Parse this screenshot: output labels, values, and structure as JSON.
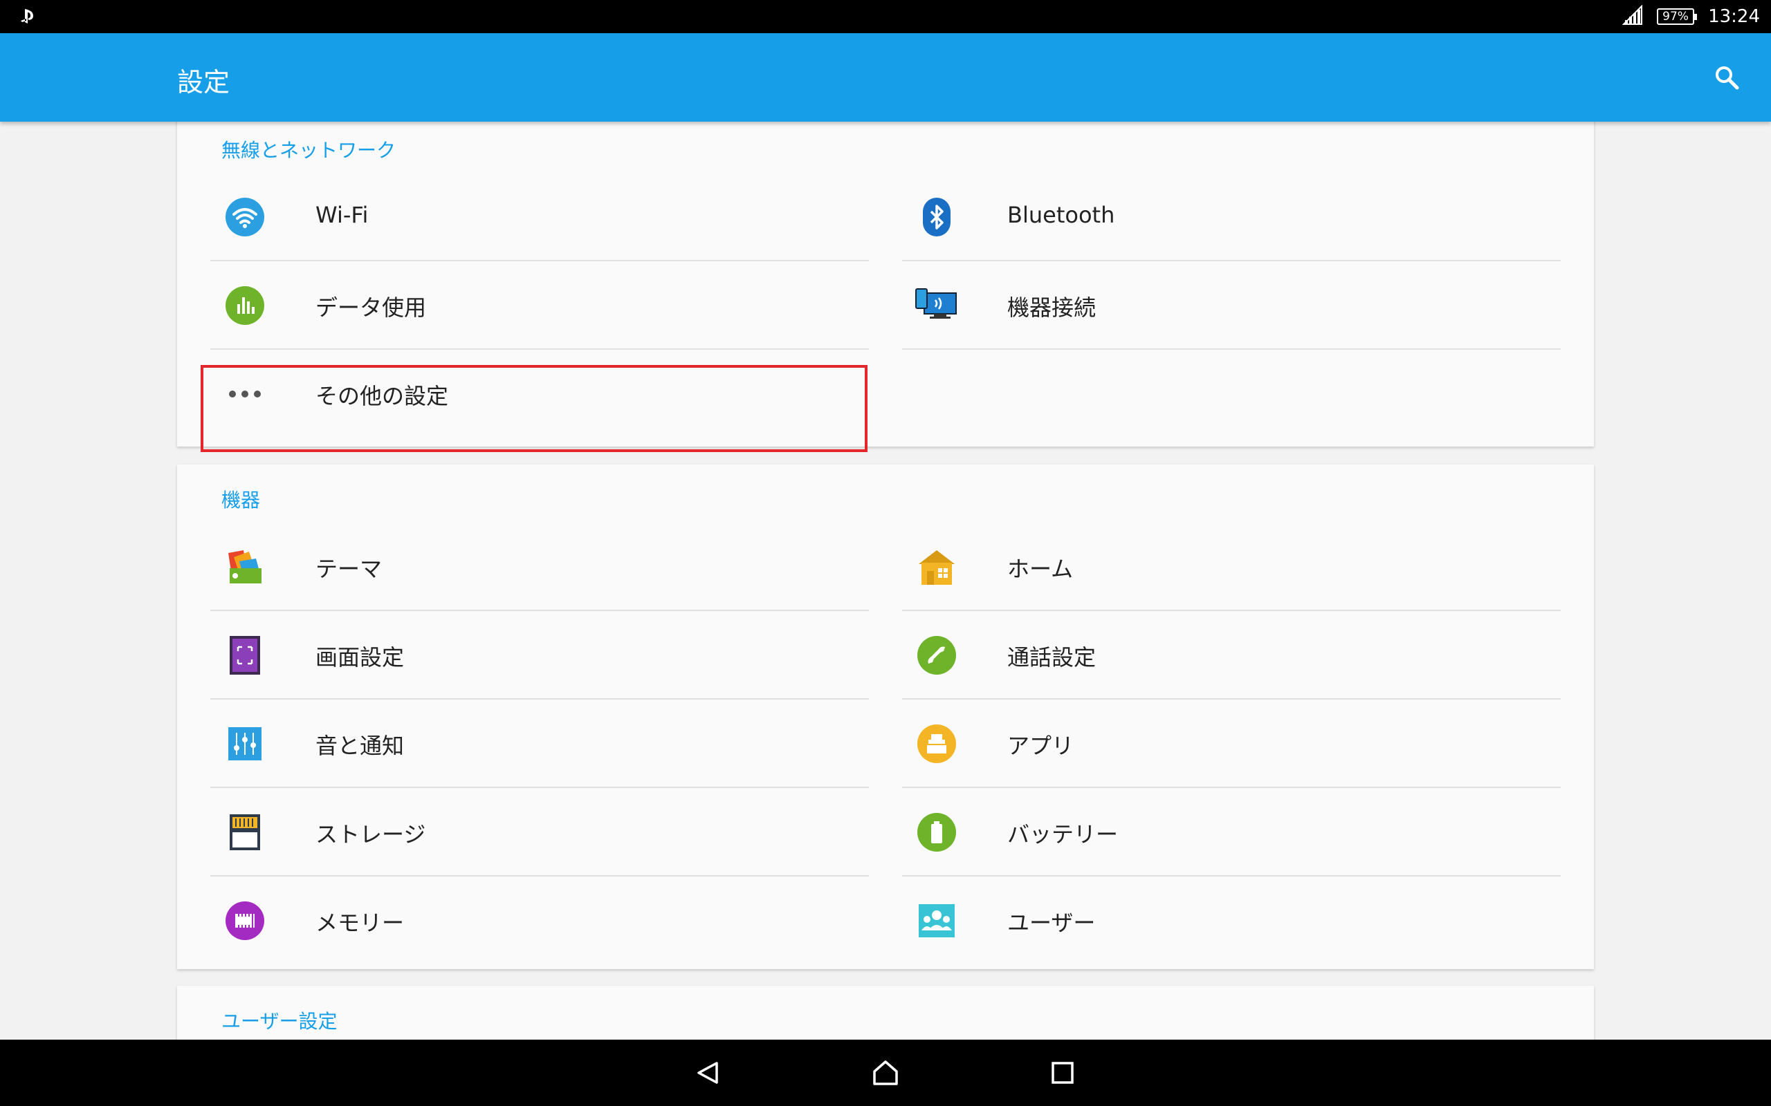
{
  "status": {
    "time": "13:24",
    "battery": "97%"
  },
  "app_bar": {
    "title": "設定"
  },
  "sections": {
    "wireless": {
      "header": "無線とネットワーク",
      "items": {
        "wifi": "Wi-Fi",
        "bluetooth": "Bluetooth",
        "data_usage": "データ使用",
        "device_connection": "機器接続",
        "more": "その他の設定"
      }
    },
    "device": {
      "header": "機器",
      "items": {
        "theme": "テーマ",
        "home": "ホーム",
        "display": "画面設定",
        "call": "通話設定",
        "sound": "音と通知",
        "apps": "アプリ",
        "storage": "ストレージ",
        "battery": "バッテリー",
        "memory": "メモリー",
        "users": "ユーザー"
      }
    },
    "user_settings": {
      "header": "ユーザー設定"
    }
  },
  "colors": {
    "accent": "#169fe8",
    "highlight": "#e4262d"
  },
  "icons": {
    "wifi": "wifi-icon",
    "bluetooth": "bluetooth-icon",
    "data_usage": "bar-chart-icon",
    "device_connection": "monitor-phone-icon",
    "more": "more-dots-icon",
    "theme": "theme-icon",
    "home": "home-icon",
    "display": "display-icon",
    "call": "phone-icon",
    "sound": "equalizer-icon",
    "apps": "apps-icon",
    "storage": "sd-card-icon",
    "battery": "battery-icon",
    "memory": "memory-chip-icon",
    "users": "users-icon"
  }
}
